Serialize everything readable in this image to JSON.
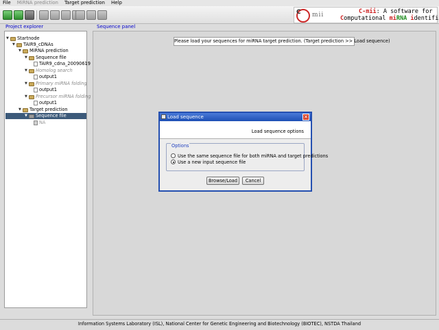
{
  "menubar": {
    "file": "File",
    "mirna_prediction": "MiRNA prediction",
    "target_prediction": "Target prediction",
    "help": "Help"
  },
  "toolbar": {
    "icons": [
      "new-project-icon",
      "open-folder-icon",
      "copy-icon",
      "document-icon",
      "document-icon",
      "document-icon",
      "document-icon",
      "zoom-icon",
      "grid-icon",
      "grid-icon"
    ]
  },
  "logo": {
    "brand": "mii",
    "line1_colored": "C-mii",
    "line1_rest": ": A software for",
    "line2_c": "C",
    "line2_a": "omputational ",
    "line2_mi": "mi",
    "line2_rna": "RNA",
    "line2_b": " ",
    "line2_i": "i",
    "line2_c2": "dentification"
  },
  "explorer": {
    "header": "Project explorer",
    "nodes": {
      "startnode": "Startnode",
      "tair": "TAIR9_cDNAs",
      "mirna_prediction": "MiRNA prediction",
      "sequence_file": "Sequence file",
      "tair_file": "TAIR9_cdna_20090619",
      "homolog_search": "Homolog search",
      "output1_a": "output1",
      "primary_folding": "Primary miRNA folding",
      "output1_b": "output1",
      "precursor_folding": "Precursor miRNA folding",
      "output1_c": "output1",
      "target_prediction": "Target prediction",
      "target_sequence_file": "Sequence file",
      "na": "NA"
    }
  },
  "sequence_panel": {
    "header": "Sequence panel",
    "hint": "Please load your sequences for miRNA target prediction. (Target prediction >> Load sequence)"
  },
  "dialog": {
    "title": "Load sequence",
    "banner": "Load sequence options",
    "options_legend": "Options",
    "option_same": "Use the same sequence file for both miRNA and target predictions",
    "option_new": "Use a new input sequence file",
    "selected_option": "new",
    "browse_label": "Browse/Load",
    "cancel_label": "Cancel"
  },
  "statusbar": {
    "text": "Information Systems Laboratory (ISL), National Center for Genetic Engineering and Biotechnology (BIOTEC), NSTDA Thailand"
  }
}
